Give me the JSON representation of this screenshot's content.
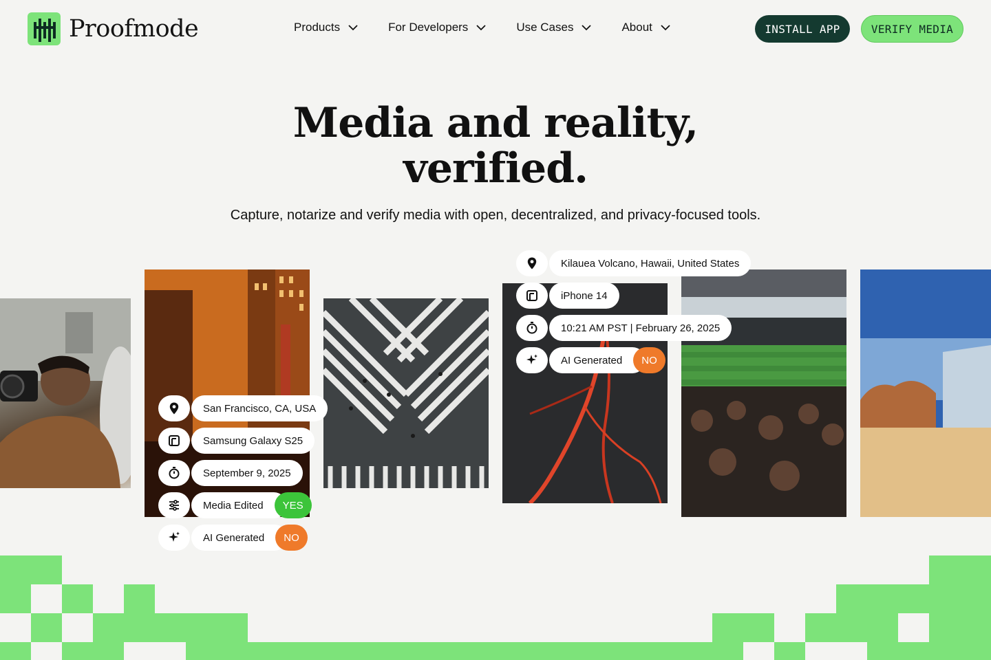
{
  "brand": {
    "name": "Proofmode",
    "accent": "#7de37a",
    "dark": "#143a30"
  },
  "nav": {
    "items": [
      {
        "label": "Products"
      },
      {
        "label": "For Developers"
      },
      {
        "label": "Use Cases"
      },
      {
        "label": "About"
      }
    ],
    "install_label": "INSTALL APP",
    "verify_label": "VERIFY MEDIA"
  },
  "hero": {
    "title_line1": "Media and reality,",
    "title_line2": "verified.",
    "subtitle": "Capture, notarize and verify media with open, decentralized, and privacy-focused tools."
  },
  "card_sf": {
    "location": "San Francisco, CA, USA",
    "device": "Samsung Galaxy S25",
    "date": "September 9, 2025",
    "edited_label": "Media Edited",
    "edited_value": "YES",
    "ai_label": "AI Generated",
    "ai_value": "NO"
  },
  "card_volcano": {
    "location": "Kilauea Volcano, Hawaii, United States",
    "device": "iPhone 14",
    "datetime": "10:21 AM PST | February 26, 2025",
    "ai_label": "AI Generated",
    "ai_value": "NO"
  },
  "icons": [
    "pin-icon",
    "phone-icon",
    "clock-icon",
    "sliders-icon",
    "sparkle-icon",
    "chevron-down-icon"
  ],
  "colors": {
    "yes": "#3cc43a",
    "no": "#ef7a2a",
    "background": "#f4f4f2"
  }
}
